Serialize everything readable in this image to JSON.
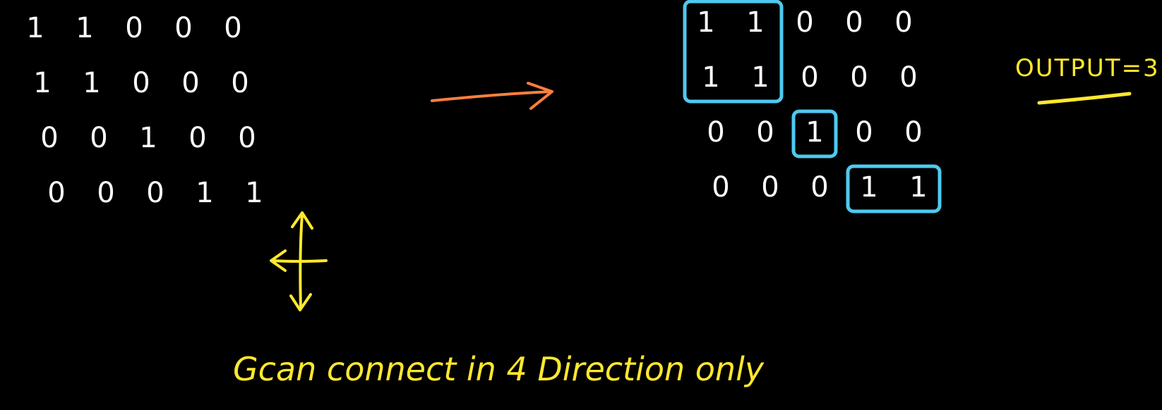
{
  "input_grid": [
    [
      "1",
      "1",
      "0",
      "0",
      "0"
    ],
    [
      "1",
      "1",
      "0",
      "0",
      "0"
    ],
    [
      "0",
      "0",
      "1",
      "0",
      "0"
    ],
    [
      "0",
      "0",
      "0",
      "1",
      "1"
    ]
  ],
  "output_grid": [
    [
      "1",
      "1",
      "0",
      "0",
      "0"
    ],
    [
      "1",
      "1",
      "0",
      "0",
      "0"
    ],
    [
      "0",
      "0",
      "1",
      "0",
      "0"
    ],
    [
      "0",
      "0",
      "0",
      "1",
      "1"
    ]
  ],
  "islands": [
    {
      "cells": [
        [
          0,
          0
        ],
        [
          0,
          1
        ],
        [
          1,
          0
        ],
        [
          1,
          1
        ]
      ]
    },
    {
      "cells": [
        [
          2,
          2
        ]
      ]
    },
    {
      "cells": [
        [
          3,
          3
        ],
        [
          3,
          4
        ]
      ]
    }
  ],
  "output_label": "OUTPUT=3",
  "direction_note": "Gcan connect in 4 Direction only",
  "colors": {
    "background": "#000000",
    "digits": "#ffffff",
    "annotation": "#ffe82e",
    "arrow": "#ff7f3f",
    "island_box": "#4fc9ef"
  },
  "icons": {
    "transform_arrow": "right-arrow-icon",
    "four_direction": "four-way-arrow-icon"
  }
}
